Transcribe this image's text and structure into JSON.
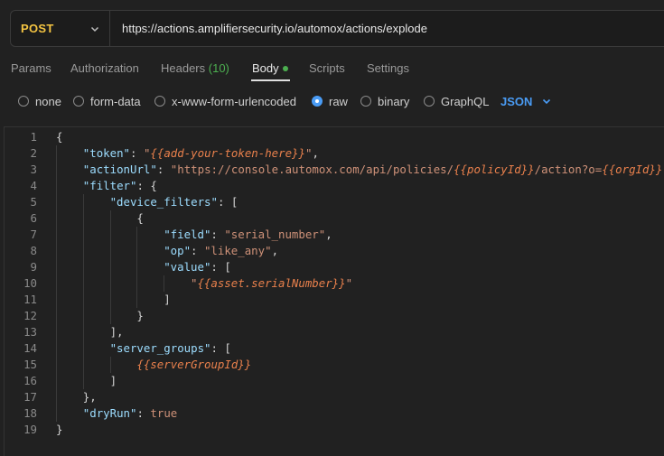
{
  "request": {
    "method": "POST",
    "url": "https://actions.amplifiersecurity.io/automox/actions/explode"
  },
  "tabs": [
    {
      "label": "Params"
    },
    {
      "label": "Authorization"
    },
    {
      "label": "Headers",
      "count": "(10)"
    },
    {
      "label": "Body"
    },
    {
      "label": "Scripts"
    },
    {
      "label": "Settings"
    }
  ],
  "body_types": [
    {
      "label": "none",
      "selected": false
    },
    {
      "label": "form-data",
      "selected": false
    },
    {
      "label": "x-www-form-urlencoded",
      "selected": false
    },
    {
      "label": "raw",
      "selected": true
    },
    {
      "label": "binary",
      "selected": false
    },
    {
      "label": "GraphQL",
      "selected": false
    }
  ],
  "raw_format": "JSON",
  "editor": {
    "line_numbers": [
      "1",
      "2",
      "3",
      "4",
      "5",
      "6",
      "7",
      "8",
      "9",
      "10",
      "11",
      "12",
      "13",
      "14",
      "15",
      "16",
      "17",
      "18",
      "19"
    ],
    "lines": [
      [
        {
          "t": "p",
          "x": "{"
        }
      ],
      [
        {
          "t": "k",
          "x": "\"token\""
        },
        {
          "t": "p",
          "x": ": "
        },
        {
          "t": "s",
          "x": "\""
        },
        {
          "t": "v",
          "x": "{{add-your-token-here}}"
        },
        {
          "t": "s",
          "x": "\""
        },
        {
          "t": "p",
          "x": ","
        }
      ],
      [
        {
          "t": "k",
          "x": "\"actionUrl\""
        },
        {
          "t": "p",
          "x": ": "
        },
        {
          "t": "s",
          "x": "\"https://console.automox.com/api/policies/"
        },
        {
          "t": "v",
          "x": "{{policyId}}"
        },
        {
          "t": "s",
          "x": "/action?o="
        },
        {
          "t": "v",
          "x": "{{orgId}}"
        },
        {
          "t": "s",
          "x": "\""
        },
        {
          "t": "p",
          "x": ","
        }
      ],
      [
        {
          "t": "k",
          "x": "\"filter\""
        },
        {
          "t": "p",
          "x": ": {"
        }
      ],
      [
        {
          "t": "k",
          "x": "\"device_filters\""
        },
        {
          "t": "p",
          "x": ": ["
        }
      ],
      [
        {
          "t": "p",
          "x": "{"
        }
      ],
      [
        {
          "t": "k",
          "x": "\"field\""
        },
        {
          "t": "p",
          "x": ": "
        },
        {
          "t": "s",
          "x": "\"serial_number\""
        },
        {
          "t": "p",
          "x": ","
        }
      ],
      [
        {
          "t": "k",
          "x": "\"op\""
        },
        {
          "t": "p",
          "x": ": "
        },
        {
          "t": "s",
          "x": "\"like_any\""
        },
        {
          "t": "p",
          "x": ","
        }
      ],
      [
        {
          "t": "k",
          "x": "\"value\""
        },
        {
          "t": "p",
          "x": ": ["
        }
      ],
      [
        {
          "t": "s",
          "x": "\""
        },
        {
          "t": "v",
          "x": "{{asset.serialNumber}}"
        },
        {
          "t": "s",
          "x": "\""
        }
      ],
      [
        {
          "t": "p",
          "x": "]"
        }
      ],
      [
        {
          "t": "p",
          "x": "}"
        }
      ],
      [
        {
          "t": "p",
          "x": "],"
        }
      ],
      [
        {
          "t": "k",
          "x": "\"server_groups\""
        },
        {
          "t": "p",
          "x": ": ["
        }
      ],
      [
        {
          "t": "v",
          "x": "{{serverGroupId}}"
        }
      ],
      [
        {
          "t": "p",
          "x": "]"
        }
      ],
      [
        {
          "t": "p",
          "x": "},"
        }
      ],
      [
        {
          "t": "k",
          "x": "\"dryRun\""
        },
        {
          "t": "p",
          "x": ": "
        },
        {
          "t": "b",
          "x": "true"
        }
      ],
      [
        {
          "t": "p",
          "x": "}"
        }
      ]
    ]
  },
  "icons": {
    "method_dropdown": "chevron-down-icon",
    "format_dropdown": "chevron-down-icon"
  },
  "colors": {
    "method": "#f5c542",
    "accent": "#4a9cf5",
    "status_green": "#4caf50",
    "json_key": "#9cdcfe",
    "json_string": "#ce9178",
    "json_variable": "#e9804c"
  }
}
